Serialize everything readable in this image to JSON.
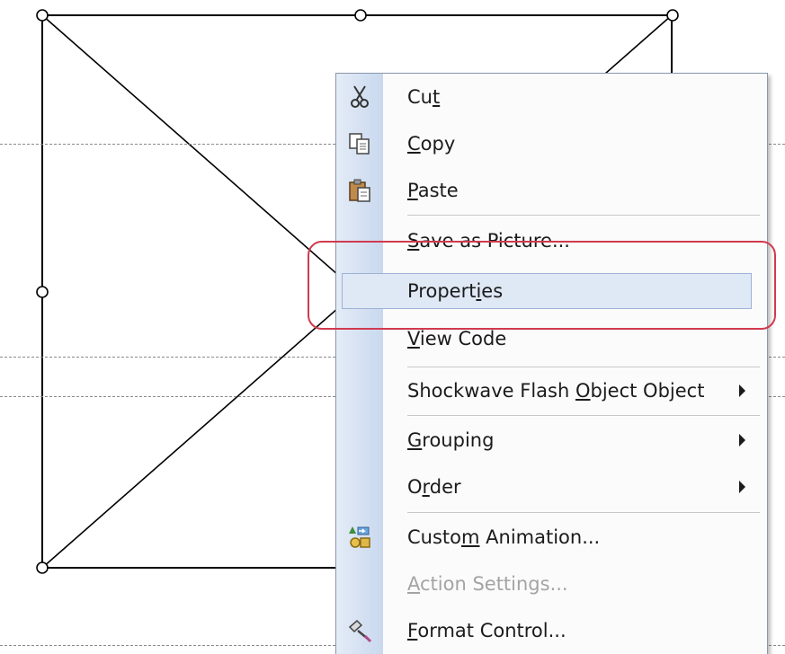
{
  "colors": {
    "menu_bg": "#fbfbfb",
    "icon_strip": "#c9d8ee",
    "highlight": "#dfe8f5",
    "annotation": "#d03a4f",
    "disabled_text": "#a4a4a4"
  },
  "context_menu": {
    "items": [
      {
        "label": "Cut",
        "accel": "t",
        "icon": "scissors-icon",
        "enabled": true,
        "submenu": false
      },
      {
        "label": "Copy",
        "accel": "C",
        "icon": "copy-icon",
        "enabled": true,
        "submenu": false
      },
      {
        "label": "Paste",
        "accel": "P",
        "icon": "clipboard-paste-icon",
        "enabled": true,
        "submenu": false
      },
      {
        "label": "Save as Picture...",
        "accel": "S",
        "icon": "",
        "enabled": true,
        "submenu": false
      },
      {
        "label": "Properties",
        "accel": "i",
        "icon": "",
        "enabled": true,
        "submenu": false,
        "highlighted": true
      },
      {
        "label": "View Code",
        "accel": "V",
        "icon": "",
        "enabled": true,
        "submenu": false
      },
      {
        "label": "Shockwave Flash Object Object",
        "accel": "O",
        "icon": "",
        "enabled": true,
        "submenu": true
      },
      {
        "label": "Grouping",
        "accel": "G",
        "icon": "",
        "enabled": true,
        "submenu": true
      },
      {
        "label": "Order",
        "accel": "r",
        "icon": "",
        "enabled": true,
        "submenu": true
      },
      {
        "label": "Custom Animation...",
        "accel": "m",
        "icon": "custom-animation-icon",
        "enabled": true,
        "submenu": false
      },
      {
        "label": "Action Settings...",
        "accel": "A",
        "icon": "",
        "enabled": false,
        "submenu": false
      },
      {
        "label": "Format Control...",
        "accel": "F",
        "icon": "format-control-icon",
        "enabled": true,
        "submenu": false
      }
    ]
  }
}
